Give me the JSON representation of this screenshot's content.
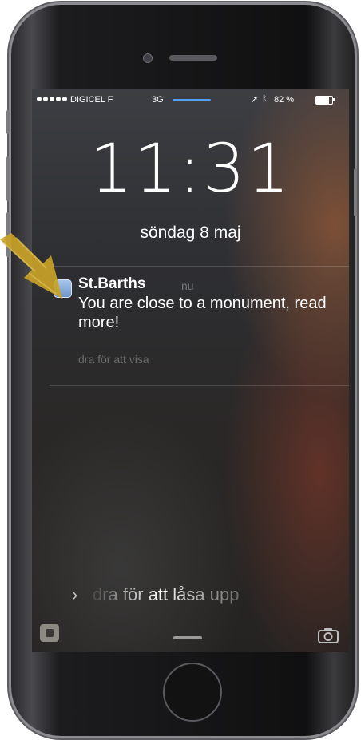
{
  "status_bar": {
    "carrier": "DIGICEL F",
    "network": "3G",
    "battery": "82 %",
    "battery_level": 0.82
  },
  "lock_screen": {
    "time": "11:31",
    "date": "söndag 8 maj"
  },
  "notification": {
    "app": "St.Barths",
    "time": "nu",
    "message": "You are close to a monument, read more!",
    "action_hint": "dra för att visa"
  },
  "unlock": {
    "label": "dra för att låsa upp"
  },
  "icons": {
    "location": "location-arrow-icon",
    "bluetooth": "bluetooth-icon",
    "camera": "camera-icon",
    "control_center": "control-center-icon",
    "annotation_arrow": "pointer-arrow-icon"
  },
  "colors": {
    "accent": "#4ea0ff",
    "annotation": "#c9a227"
  }
}
